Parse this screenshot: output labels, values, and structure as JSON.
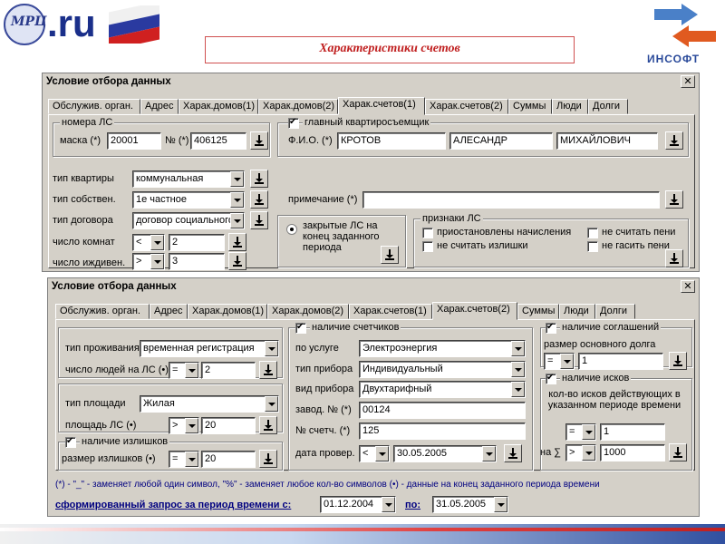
{
  "header": {
    "logo_site": ".ru",
    "slide_title": "Характеристики счетов",
    "brand": "ИНСОФТ"
  },
  "w1": {
    "title": "Условие отбора данных",
    "close": "✕",
    "tabs": [
      "Обслужив. орган.",
      "Адрес",
      "Харак.домов(1)",
      "Харак.домов(2)",
      "Харак.счетов(1)",
      "Харак.счетов(2)",
      "Суммы",
      "Люди",
      "Долги"
    ],
    "ls_group": "номера ЛС",
    "mask_label": "маска (*)",
    "mask_value": "20001",
    "num_label": "№ (*)",
    "num_value": "406125",
    "resp_group": "главный квартиросъемщик",
    "fio_label": "Ф.И.О. (*)",
    "fio_last": "КРОТОВ",
    "fio_first": "АЛЕСАНДР",
    "fio_middle": "МИХАЙЛОВИЧ",
    "apt_type_label": "тип квартиры",
    "apt_type": "коммунальная",
    "own_label": "тип собствен.",
    "own": "1е частное",
    "contract_label": "тип договора",
    "contract": "договор социального",
    "rooms_label": "число комнат",
    "rooms_op": "<",
    "rooms": "2",
    "dep_label": "число иждивен.",
    "dep_op": ">",
    "dep": "3",
    "note_label": "примечание (*)",
    "note": "",
    "closed_label": "закрытые ЛС на конец заданного периода",
    "signs_group": "признаки ЛС",
    "sign1": "приостановлены начисления",
    "sign2": "не считать пени",
    "sign3": "не считать излишки",
    "sign4": "не гасить пени"
  },
  "w2": {
    "title": "Условие отбора данных",
    "close": "✕",
    "tabs": [
      "Обслужив. орган.",
      "Адрес",
      "Харак.домов(1)",
      "Харак.домов(2)",
      "Харак.счетов(1)",
      "Харак.счетов(2)",
      "Суммы",
      "Люди",
      "Долги"
    ],
    "res_label": "тип проживания",
    "res": "временная регистрация",
    "people_label": "число людей на ЛС (•)",
    "people_op": "=",
    "people": "2",
    "area_type_label": "тип площади",
    "area_type": "Жилая",
    "area_label": "площадь ЛС (•)",
    "area_op": ">",
    "area": "20",
    "surplus_group": "наличие излишков",
    "surplus_label": "размер излишков (•)",
    "surplus_op": "=",
    "surplus": "20",
    "meters_group": "наличие счетчиков",
    "service_label": "по услуге",
    "service": "Электроэнергия",
    "device_label": "тип прибора",
    "device": "Индивидуальный",
    "kind_label": "вид прибора",
    "kind": "Двухтарифный",
    "factory_label": "завод. № (*)",
    "factory": "00124",
    "meter_label": "№ счетч. (*)",
    "meter": "125",
    "check_label": "дата провер.",
    "check_op": "<",
    "check_date": "30.05.2005",
    "agree_group": "наличие соглашений",
    "debt_label": "размер основного долга",
    "debt_op": "=",
    "debt": "1",
    "suits_group": "наличие исков",
    "suits_label": "кол-во исков действующих в указанном периоде времени",
    "suits_op": "=",
    "suits": "1",
    "sum_label": "на ∑",
    "sum_op": ">",
    "sum": "1000",
    "footnote": "(*) - \"_\" - заменяет любой один символ, \"%\" - заменяет любое кол-во символов     (•) - данные на конец заданного периода времени",
    "period_label": "сформированный запрос за период времени с:",
    "from": "01.12.2004",
    "to_label": "по:",
    "to": "31.05.2005"
  }
}
